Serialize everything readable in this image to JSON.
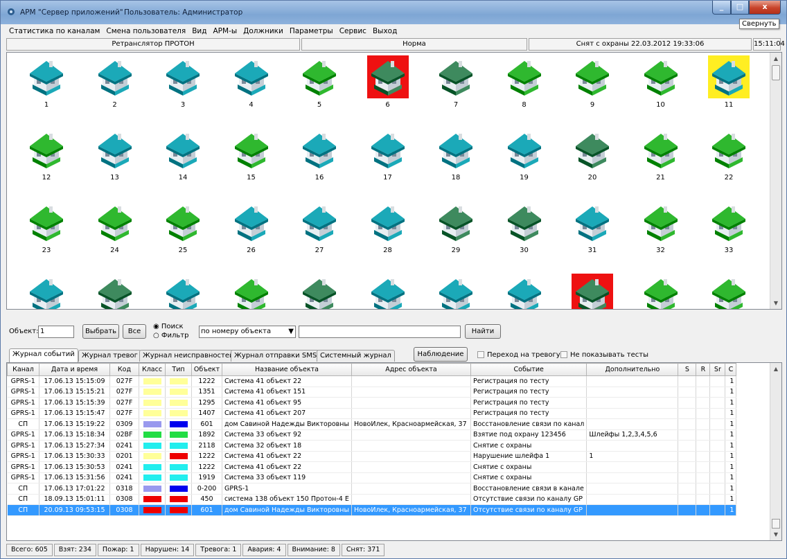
{
  "window": {
    "app_title": "АРМ \"Сервер приложений\"",
    "user_label": "Пользователь: Администратор",
    "tooltip": "Свернуть",
    "min_glyph": "_",
    "max_glyph": "□",
    "close_glyph": "x"
  },
  "menu": [
    "Статистика по каналам",
    "Смена пользователя",
    "Вид",
    "АРМ-ы",
    "Должники",
    "Параметры",
    "Сервис",
    "Выход"
  ],
  "status_top": {
    "relay": "Ретранслятор ПРОТОН",
    "state": "Норма",
    "guard": "Снят с охраны 22.03.2012 19:33:06",
    "time": "15:11:04"
  },
  "colors": {
    "teal": "#1ba9b8",
    "green": "#2fb82f",
    "dark_green": "#3e8a5e",
    "alarm_red": "#ee1111",
    "warn_yellow": "#ffee22",
    "select_blue": "#3399ff"
  },
  "objects": [
    {
      "n": "1",
      "roof": "teal",
      "wall": "teal",
      "bg": ""
    },
    {
      "n": "2",
      "roof": "teal",
      "wall": "teal",
      "bg": ""
    },
    {
      "n": "3",
      "roof": "teal",
      "wall": "teal",
      "bg": ""
    },
    {
      "n": "4",
      "roof": "teal",
      "wall": "teal",
      "bg": ""
    },
    {
      "n": "5",
      "roof": "green",
      "wall": "green",
      "bg": ""
    },
    {
      "n": "6",
      "roof": "dark_green",
      "wall": "dark_green",
      "bg": "alarm_red"
    },
    {
      "n": "7",
      "roof": "dark_green",
      "wall": "dark_green",
      "bg": ""
    },
    {
      "n": "8",
      "roof": "green",
      "wall": "green",
      "bg": ""
    },
    {
      "n": "9",
      "roof": "green",
      "wall": "green",
      "bg": ""
    },
    {
      "n": "10",
      "roof": "green",
      "wall": "green",
      "bg": ""
    },
    {
      "n": "11",
      "roof": "teal",
      "wall": "teal",
      "bg": "warn_yellow"
    },
    {
      "n": "12",
      "roof": "green",
      "wall": "green",
      "bg": ""
    },
    {
      "n": "13",
      "roof": "teal",
      "wall": "teal",
      "bg": ""
    },
    {
      "n": "14",
      "roof": "teal",
      "wall": "teal",
      "bg": ""
    },
    {
      "n": "15",
      "roof": "green",
      "wall": "green",
      "bg": ""
    },
    {
      "n": "16",
      "roof": "teal",
      "wall": "teal",
      "bg": ""
    },
    {
      "n": "17",
      "roof": "teal",
      "wall": "teal",
      "bg": ""
    },
    {
      "n": "18",
      "roof": "teal",
      "wall": "teal",
      "bg": ""
    },
    {
      "n": "19",
      "roof": "teal",
      "wall": "teal",
      "bg": ""
    },
    {
      "n": "20",
      "roof": "dark_green",
      "wall": "dark_green",
      "bg": ""
    },
    {
      "n": "21",
      "roof": "green",
      "wall": "green",
      "bg": ""
    },
    {
      "n": "22",
      "roof": "green",
      "wall": "green",
      "bg": ""
    },
    {
      "n": "23",
      "roof": "green",
      "wall": "green",
      "bg": ""
    },
    {
      "n": "24",
      "roof": "green",
      "wall": "green",
      "bg": ""
    },
    {
      "n": "25",
      "roof": "green",
      "wall": "green",
      "bg": ""
    },
    {
      "n": "26",
      "roof": "teal",
      "wall": "teal",
      "bg": ""
    },
    {
      "n": "27",
      "roof": "teal",
      "wall": "teal",
      "bg": ""
    },
    {
      "n": "28",
      "roof": "teal",
      "wall": "teal",
      "bg": ""
    },
    {
      "n": "29",
      "roof": "dark_green",
      "wall": "dark_green",
      "bg": ""
    },
    {
      "n": "30",
      "roof": "dark_green",
      "wall": "dark_green",
      "bg": ""
    },
    {
      "n": "31",
      "roof": "teal",
      "wall": "teal",
      "bg": ""
    },
    {
      "n": "32",
      "roof": "green",
      "wall": "green",
      "bg": ""
    },
    {
      "n": "33",
      "roof": "green",
      "wall": "green",
      "bg": ""
    },
    {
      "n": "",
      "roof": "teal",
      "wall": "teal",
      "bg": ""
    },
    {
      "n": "",
      "roof": "dark_green",
      "wall": "dark_green",
      "bg": ""
    },
    {
      "n": "",
      "roof": "teal",
      "wall": "teal",
      "bg": ""
    },
    {
      "n": "",
      "roof": "green",
      "wall": "green",
      "bg": ""
    },
    {
      "n": "",
      "roof": "dark_green",
      "wall": "dark_green",
      "bg": ""
    },
    {
      "n": "",
      "roof": "teal",
      "wall": "teal",
      "bg": ""
    },
    {
      "n": "",
      "roof": "teal",
      "wall": "teal",
      "bg": ""
    },
    {
      "n": "",
      "roof": "teal",
      "wall": "teal",
      "bg": ""
    },
    {
      "n": "",
      "roof": "dark_green",
      "wall": "dark_green",
      "bg": "alarm_red"
    },
    {
      "n": "",
      "roof": "green",
      "wall": "green",
      "bg": ""
    },
    {
      "n": "",
      "roof": "green",
      "wall": "green",
      "bg": ""
    }
  ],
  "filter": {
    "object_label": "Объект:",
    "object_value": "1",
    "select_btn": "Выбрать",
    "all_btn": "Все",
    "search_radio": "Поиск",
    "filter_radio": "Фильтр",
    "mode_select": "по номеру объекта",
    "search_value": "",
    "find_btn": "Найти"
  },
  "tabs": [
    "Журнал событий",
    "Журнал тревог",
    "Журнал неисправностей",
    "Журнал отправки SMS",
    "Системный журнал"
  ],
  "observe_btn": "Наблюдение",
  "chk_alarm": "Переход на тревогу",
  "chk_tests": "Не показывать тесты",
  "table": {
    "headers": [
      "Канал",
      "Дата и время",
      "Код",
      "Класс",
      "Тип",
      "Объект",
      "Название объекта",
      "Адрес объекта",
      "Событие",
      "Дополнительно",
      "S",
      "R",
      "Sr",
      "C"
    ],
    "rows": [
      {
        "ch": "GPRS-1",
        "dt": "17.06.13  15:15:09",
        "code": "027F",
        "cls": "#ffff99",
        "typ": "#ffff99",
        "obj": "1222",
        "name": "Система 41 объект 22",
        "addr": "",
        "evt": "Регистрация по тесту",
        "extra": "",
        "c": "1"
      },
      {
        "ch": "GPRS-1",
        "dt": "17.06.13  15:15:21",
        "code": "027F",
        "cls": "#ffff99",
        "typ": "#ffff99",
        "obj": "1351",
        "name": "Система 41 объект 151",
        "addr": "",
        "evt": "Регистрация по тесту",
        "extra": "",
        "c": "1"
      },
      {
        "ch": "GPRS-1",
        "dt": "17.06.13  15:15:39",
        "code": "027F",
        "cls": "#ffff99",
        "typ": "#ffff99",
        "obj": "1295",
        "name": "Система 41 объект 95",
        "addr": "",
        "evt": "Регистрация по тесту",
        "extra": "",
        "c": "1"
      },
      {
        "ch": "GPRS-1",
        "dt": "17.06.13  15:15:47",
        "code": "027F",
        "cls": "#ffff99",
        "typ": "#ffff99",
        "obj": "1407",
        "name": "Система 41 объект 207",
        "addr": "",
        "evt": "Регистрация по тесту",
        "extra": "",
        "c": "1"
      },
      {
        "ch": "СП",
        "dt": "17.06.13  15:19:22",
        "code": "0309",
        "cls": "#9999ee",
        "typ": "#0000ee",
        "obj": "601",
        "name": "дом Савиной Надежды Викторовны",
        "addr": "НовоИлек, Красноармейская, 37",
        "evt": "Восстановление связи по канал",
        "extra": "",
        "c": "1"
      },
      {
        "ch": "GPRS-1",
        "dt": "17.06.13  15:18:34",
        "code": "02BF",
        "cls": "#22dd44",
        "typ": "#22dd44",
        "obj": "1892",
        "name": "Система 33 объект 92",
        "addr": "",
        "evt": "Взятие под охрану 123456",
        "extra": "Шлейфы 1,2,3,4,5,6",
        "c": "1"
      },
      {
        "ch": "GPRS-1",
        "dt": "17.06.13  15:27:34",
        "code": "0241",
        "cls": "#22eeee",
        "typ": "#22eeee",
        "obj": "2118",
        "name": "Система 32 объект 18",
        "addr": "",
        "evt": "Снятие с охраны",
        "extra": "",
        "c": "1"
      },
      {
        "ch": "GPRS-1",
        "dt": "17.06.13  15:30:33",
        "code": "0201",
        "cls": "#ffff99",
        "typ": "#ee0000",
        "obj": "1222",
        "name": "Система 41 объект 22",
        "addr": "",
        "evt": "Нарушение шлейфа 1",
        "extra": "1",
        "c": "1"
      },
      {
        "ch": "GPRS-1",
        "dt": "17.06.13  15:30:53",
        "code": "0241",
        "cls": "#22eeee",
        "typ": "#22eeee",
        "obj": "1222",
        "name": "Система 41 объект 22",
        "addr": "",
        "evt": "Снятие с охраны",
        "extra": "",
        "c": "1"
      },
      {
        "ch": "GPRS-1",
        "dt": "17.06.13  15:31:56",
        "code": "0241",
        "cls": "#22eeee",
        "typ": "#22eeee",
        "obj": "1919",
        "name": "Система 33 объект 119",
        "addr": "",
        "evt": "Снятие с охраны",
        "extra": "",
        "c": "1"
      },
      {
        "ch": "СП",
        "dt": "17.06.13  17:01:22",
        "code": "0318",
        "cls": "#9999ee",
        "typ": "#0000ee",
        "obj": "0-200",
        "name": "GPRS-1",
        "addr": "",
        "evt": "Восстановление связи в канале",
        "extra": "",
        "c": "1"
      },
      {
        "ch": "СП",
        "dt": "18.09.13  15:01:11",
        "code": "0308",
        "cls": "#ee0000",
        "typ": "#ee0000",
        "obj": "450",
        "name": "система 138 объект 150  Протон-4 Е",
        "addr": "",
        "evt": "Отсутствие связи по каналу GP",
        "extra": "",
        "c": "1"
      },
      {
        "ch": "СП",
        "dt": "20.09.13  09:53:15",
        "code": "0308",
        "cls": "#ee0000",
        "typ": "#ee0000",
        "obj": "601",
        "name": "дом Савиной Надежды Викторовны",
        "addr": "НовоИлек, Красноармейская, 37",
        "evt": "Отсутствие связи по каналу GP",
        "extra": "",
        "c": "1",
        "selected": true
      }
    ]
  },
  "bottom": [
    "Всего: 605",
    "Взят: 234",
    "Пожар: 1",
    "Нарушен: 14",
    "Тревога: 1",
    "Авария: 4",
    "Внимание: 8",
    "Снят: 371"
  ]
}
